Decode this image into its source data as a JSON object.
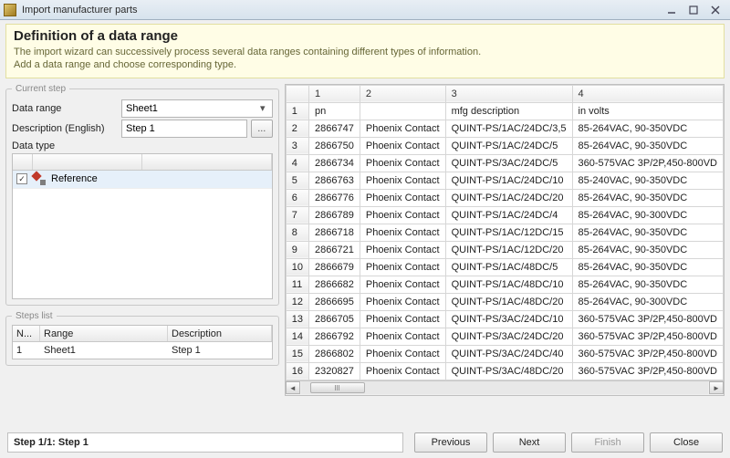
{
  "window": {
    "title": "Import manufacturer parts"
  },
  "banner": {
    "heading": "Definition of a data range",
    "line1": "The import wizard can successively process several data ranges containing different types of information.",
    "line2": "Add a data range and choose corresponding type."
  },
  "currentStep": {
    "legend": "Current step",
    "dataRangeLabel": "Data range",
    "dataRangeValue": "Sheet1",
    "descriptionLabel": "Description (English)",
    "descriptionValue": "Step 1",
    "dataTypeLabel": "Data type",
    "dataTypeItem": "Reference"
  },
  "stepsList": {
    "legend": "Steps list",
    "headers": {
      "num": "N...",
      "range": "Range",
      "desc": "Description"
    },
    "row": {
      "num": "1",
      "range": "Sheet1",
      "desc": "Step 1"
    }
  },
  "grid": {
    "colHeaders": [
      "1",
      "2",
      "3",
      "4"
    ],
    "headerRow": [
      "pn",
      "",
      "mfg description",
      "in volts"
    ],
    "rows": [
      [
        "2866747",
        "Phoenix Contact",
        "QUINT-PS/1AC/24DC/3,5",
        "85-264VAC, 90-350VDC"
      ],
      [
        "2866750",
        "Phoenix Contact",
        "QUINT-PS/1AC/24DC/5",
        "85-264VAC, 90-350VDC"
      ],
      [
        "2866734",
        "Phoenix Contact",
        "QUINT-PS/3AC/24DC/5",
        "360-575VAC 3P/2P,450-800VD"
      ],
      [
        "2866763",
        "Phoenix Contact",
        "QUINT-PS/1AC/24DC/10",
        "85-240VAC, 90-350VDC"
      ],
      [
        "2866776",
        "Phoenix Contact",
        "QUINT-PS/1AC/24DC/20",
        "85-264VAC, 90-350VDC"
      ],
      [
        "2866789",
        "Phoenix Contact",
        "QUINT-PS/1AC/24DC/4",
        "85-264VAC, 90-300VDC"
      ],
      [
        "2866718",
        "Phoenix Contact",
        "QUINT-PS/1AC/12DC/15",
        "85-264VAC, 90-350VDC"
      ],
      [
        "2866721",
        "Phoenix Contact",
        "QUINT-PS/1AC/12DC/20",
        "85-264VAC, 90-350VDC"
      ],
      [
        "2866679",
        "Phoenix Contact",
        "QUINT-PS/1AC/48DC/5",
        "85-264VAC, 90-350VDC"
      ],
      [
        "2866682",
        "Phoenix Contact",
        "QUINT-PS/1AC/48DC/10",
        "85-264VAC, 90-350VDC"
      ],
      [
        "2866695",
        "Phoenix Contact",
        "QUINT-PS/1AC/48DC/20",
        "85-264VAC, 90-300VDC"
      ],
      [
        "2866705",
        "Phoenix Contact",
        "QUINT-PS/3AC/24DC/10",
        "360-575VAC 3P/2P,450-800VD"
      ],
      [
        "2866792",
        "Phoenix Contact",
        "QUINT-PS/3AC/24DC/20",
        "360-575VAC 3P/2P,450-800VD"
      ],
      [
        "2866802",
        "Phoenix Contact",
        "QUINT-PS/3AC/24DC/40",
        "360-575VAC 3P/2P,450-800VD"
      ],
      [
        "2320827",
        "Phoenix Contact",
        "QUINT-PS/3AC/48DC/20",
        "360-575VAC 3P/2P,450-800VD"
      ]
    ]
  },
  "footer": {
    "status": "Step 1/1: Step 1",
    "previous": "Previous",
    "next": "Next",
    "finish": "Finish",
    "close": "Close"
  }
}
